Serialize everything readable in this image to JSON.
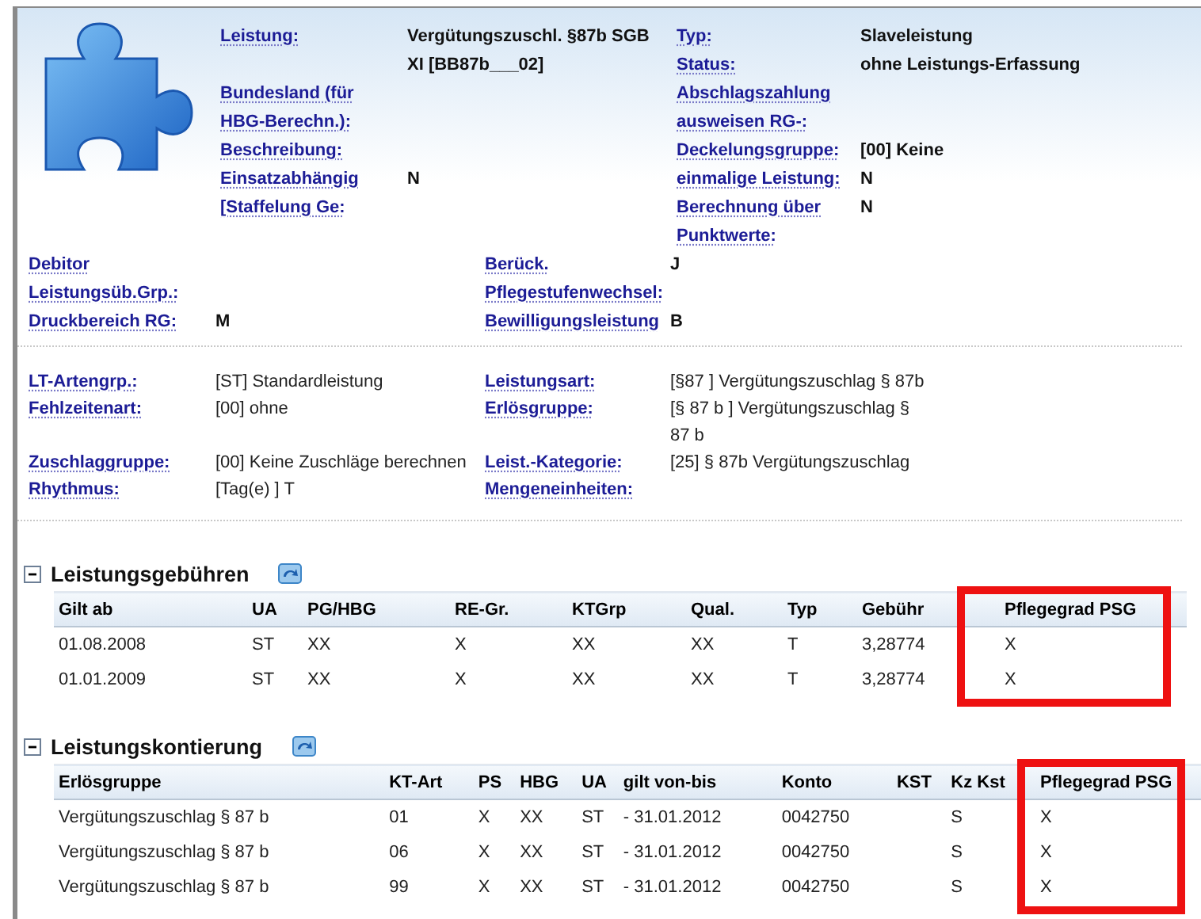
{
  "header": {
    "left_fields": [
      {
        "label": "Leistung:",
        "value": "Vergütungszuschl. §87b SGB XI [BB87b___02]"
      },
      {
        "label": "Bundesland (für HBG-Berechn.):"
      },
      {
        "label": "Beschreibung:"
      },
      {
        "label": "Einsatzabhängig",
        "value": "N"
      },
      {
        "label": "[Staffelung Ge:"
      }
    ],
    "right_fields": [
      {
        "label": "Typ:",
        "value": "Slaveleistung"
      },
      {
        "label": "Status:",
        "value": "ohne Leistungs-Erfassung"
      },
      {
        "label": "Abschlagszahlung ausweisen RG-:"
      },
      {
        "label": "Deckelungsgruppe:",
        "value": "[00] Keine"
      },
      {
        "label": "einmalige Leistung:",
        "value": "N"
      },
      {
        "label": "Berechnung über Punktwerte:",
        "value": "N"
      }
    ]
  },
  "summary": [
    [
      {
        "label": "Debitor"
      },
      {
        "label": "Berück.",
        "value": "J"
      }
    ],
    [
      {
        "label": "Leistungsüb.Grp.:"
      },
      {
        "label": "Pflegestufenwechsel:"
      }
    ],
    [
      {
        "label": "Druckbereich RG:",
        "value": "M"
      },
      {
        "label": "Bewilligungsleistung",
        "value": "B"
      }
    ]
  ],
  "classification": [
    [
      {
        "label": "LT-Artengrp.:",
        "value": "[ST] Standardleistung"
      },
      {
        "label": "Leistungsart:",
        "value": "[§87 ] Vergütungszuschlag § 87b"
      }
    ],
    [
      {
        "label": "Fehlzeitenart:",
        "value": "[00] ohne"
      },
      {
        "label": "Erlösgruppe:",
        "value": "[§ 87 b ] Vergütungszuschlag § 87 b"
      }
    ],
    [
      {
        "label": "Zuschlaggruppe:",
        "value": "[00] Keine Zuschläge berechnen"
      },
      {
        "label": "Leist.-Kategorie:",
        "value": "[25] § 87b Vergütungszuschlag"
      }
    ],
    [
      {
        "label": "Rhythmus:",
        "value": "[Tag(e) ] T"
      },
      {
        "label": "Mengeneinheiten:"
      }
    ]
  ],
  "sections": [
    {
      "title": "Leistungsgebühren",
      "expanded": true,
      "columns": [
        {
          "label": "Gilt ab",
          "highlighted": false
        },
        {
          "label": "UA",
          "highlighted": false
        },
        {
          "label": "PG/HBG",
          "highlighted": false
        },
        {
          "label": "RE-Gr.",
          "highlighted": false
        },
        {
          "label": "KTGrp",
          "highlighted": false
        },
        {
          "label": "Qual.",
          "highlighted": false
        },
        {
          "label": "Typ",
          "highlighted": false
        },
        {
          "label": "Gebühr",
          "highlighted": false
        },
        {
          "label": "Pflegegrad PSG",
          "highlighted": true
        }
      ],
      "rows": [
        [
          "01.08.2008",
          "ST",
          "XX",
          "X",
          "XX",
          "XX",
          "T",
          "3,28774",
          "X"
        ],
        [
          "01.01.2009",
          "ST",
          "XX",
          "X",
          "XX",
          "XX",
          "T",
          "3,28774",
          "X"
        ]
      ]
    },
    {
      "title": "Leistungskontierung",
      "expanded": true,
      "columns": [
        {
          "label": "Erlösgruppe",
          "highlighted": false
        },
        {
          "label": "KT-Art",
          "highlighted": false
        },
        {
          "label": "PS",
          "highlighted": false
        },
        {
          "label": "HBG",
          "highlighted": false
        },
        {
          "label": "UA",
          "highlighted": false
        },
        {
          "label": "gilt von-bis",
          "highlighted": false
        },
        {
          "label": "Konto",
          "highlighted": false
        },
        {
          "label": "KST",
          "highlighted": false
        },
        {
          "label": "Kz Kst",
          "highlighted": false
        },
        {
          "label": "Pflegegrad PSG",
          "highlighted": true
        }
      ],
      "rows": [
        [
          "Vergütungszuschlag § 87 b",
          "01",
          "X",
          "XX",
          "ST",
          "- 31.01.2012",
          "0042750",
          "",
          "S",
          "X"
        ],
        [
          "Vergütungszuschlag § 87 b",
          "06",
          "X",
          "XX",
          "ST",
          "- 31.01.2012",
          "0042750",
          "",
          "S",
          "X"
        ],
        [
          "Vergütungszuschlag § 87 b",
          "99",
          "X",
          "XX",
          "ST",
          "- 31.01.2012",
          "0042750",
          "",
          "S",
          "X"
        ]
      ]
    }
  ]
}
